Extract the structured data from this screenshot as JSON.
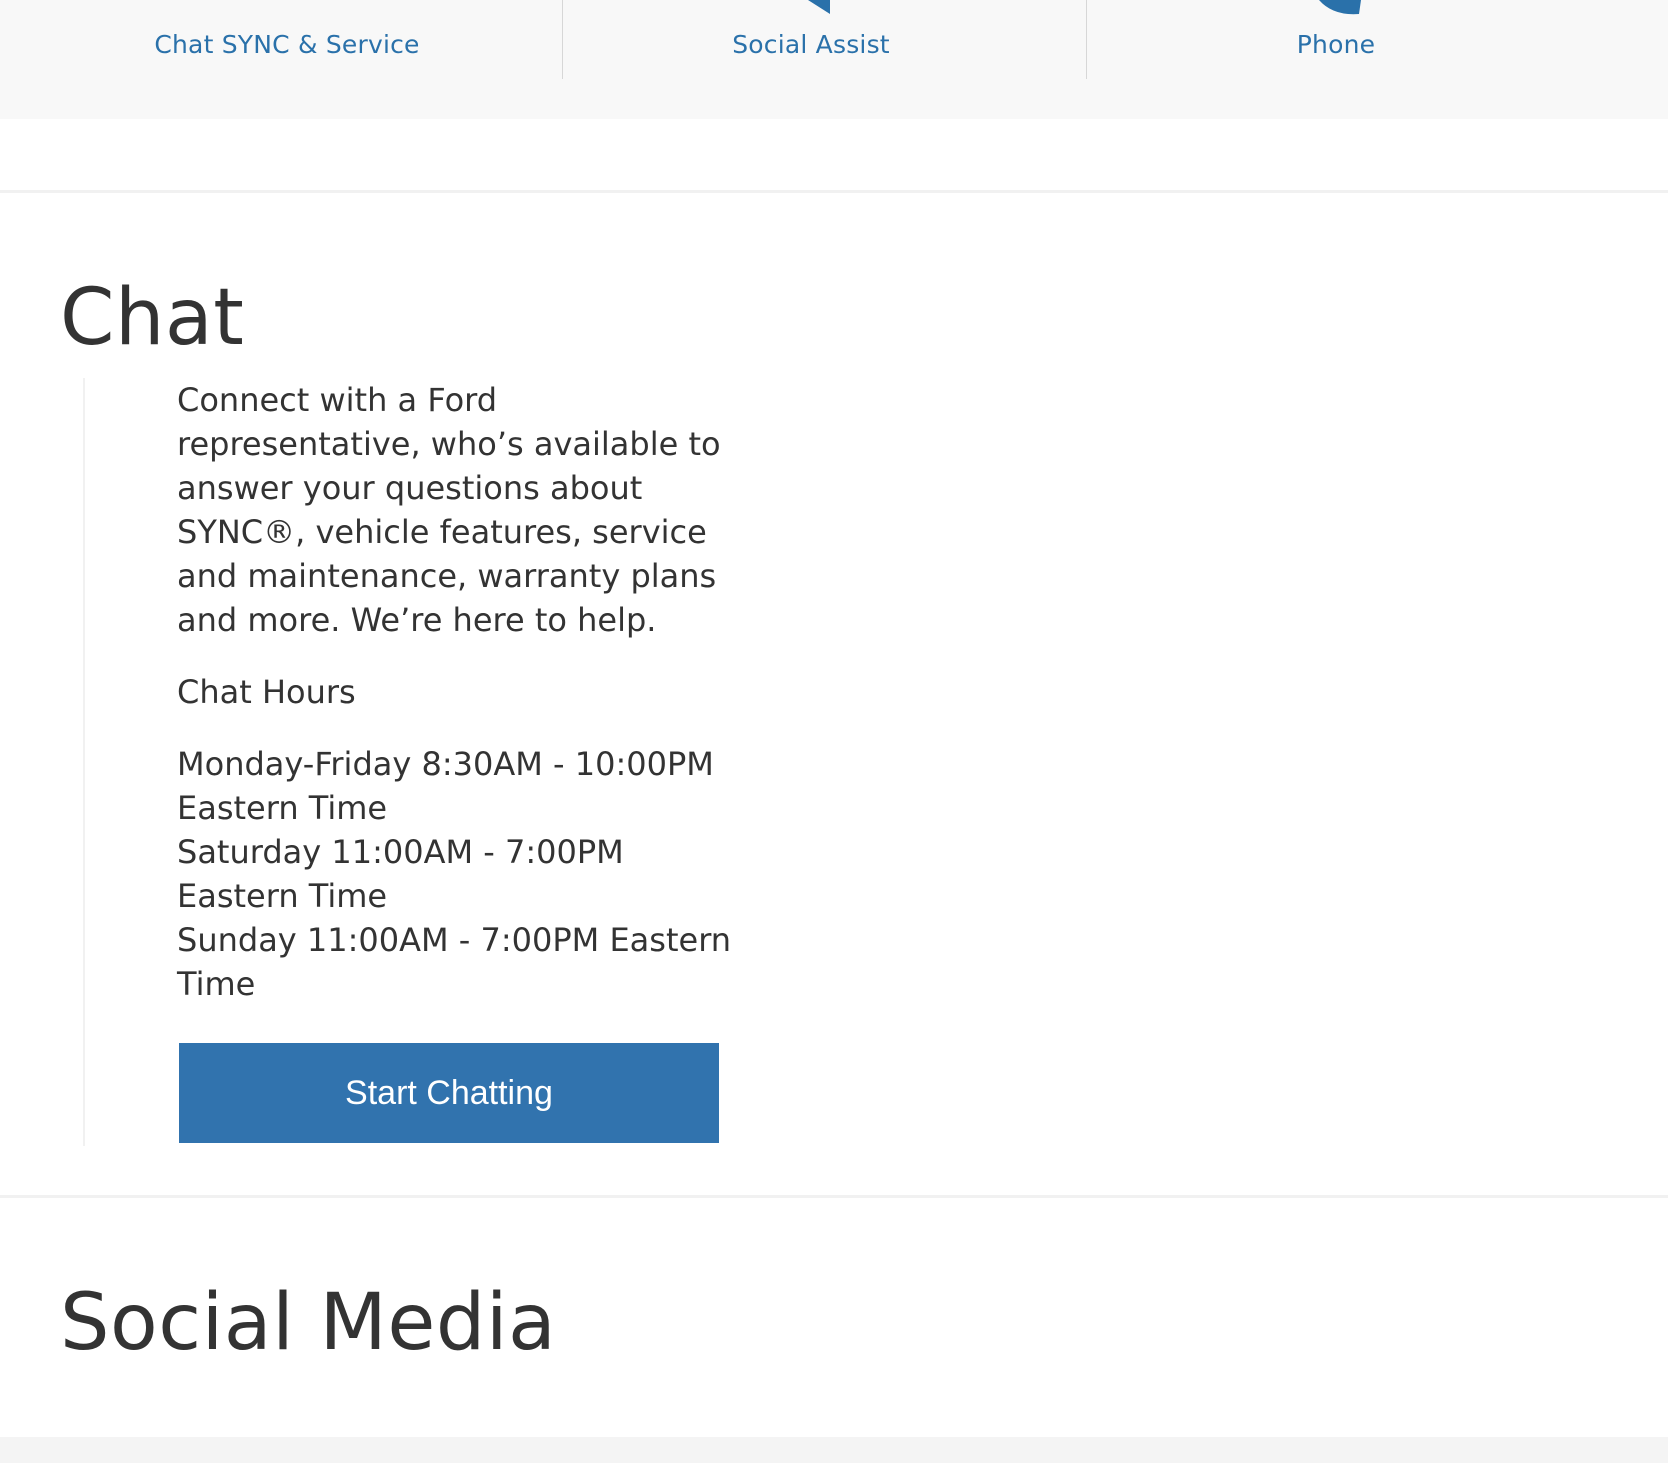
{
  "contact_nav": {
    "items": [
      {
        "label": "Chat SYNC & Service",
        "icon": "chat-icon"
      },
      {
        "label": "Social Assist",
        "icon": "social-icon"
      },
      {
        "label": "Phone",
        "icon": "phone-icon"
      }
    ],
    "accent_color": "#2a71aa"
  },
  "chat_section": {
    "heading": "Chat",
    "description": "Connect with a Ford representative, who’s available to answer your questions about SYNC®, vehicle features, service and maintenance, warranty plans and more. We’re here to help.",
    "hours_title": "Chat Hours",
    "hours": [
      "Monday-Friday 8:30AM - 10:00PM Eastern Time",
      "Saturday 11:00AM - 7:00PM Eastern Time",
      "Sunday 11:00AM - 7:00PM Eastern Time"
    ],
    "button_label": "Start Chatting",
    "button_color": "#3173ae"
  },
  "social_section": {
    "heading": "Social Media"
  }
}
